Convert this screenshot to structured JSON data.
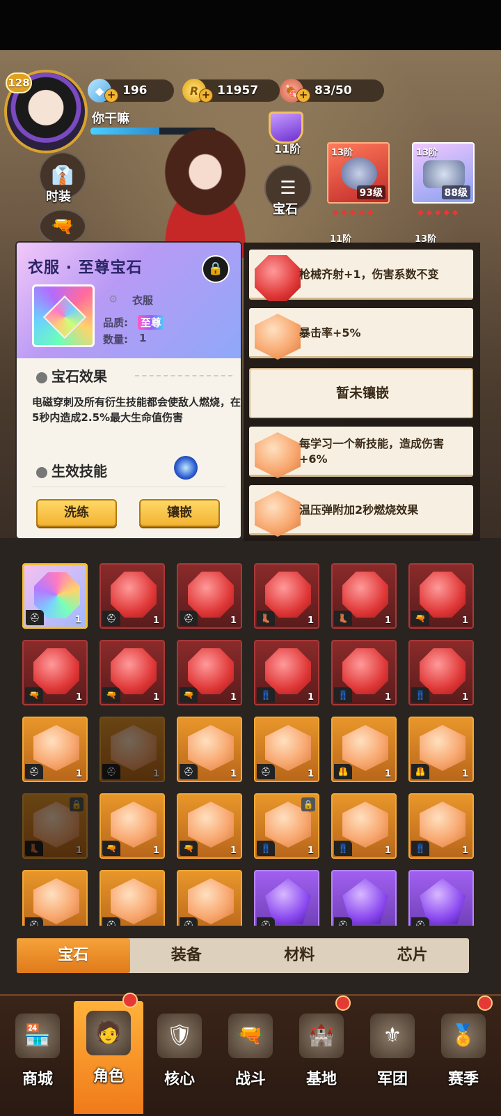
{
  "header": {
    "level": "128",
    "player_name": "你干嘛",
    "exp_fraction": 0.55,
    "resources": {
      "diamonds": "196",
      "coins": "11957",
      "stamina": "83/50"
    }
  },
  "side_buttons": {
    "fashion_label": "时装",
    "gem_label": "宝石",
    "rank_label": "11阶"
  },
  "equipment": [
    {
      "tier": "13阶",
      "level": "93级"
    },
    {
      "tier": "13阶",
      "level": "88级"
    },
    {
      "tier": "11阶"
    },
    {
      "tier": "13阶"
    }
  ],
  "detail": {
    "title": "衣服 · 至尊宝石",
    "slot_type": "衣服",
    "quality_label": "品质:",
    "quality_value": "至尊",
    "count_label": "数量:",
    "count_value": "1",
    "effect_title": "宝石效果",
    "effect_text": "电磁穿刺及所有衍生技能都会使敌人燃烧，在5秒内造成2.5%最大生命值伤害",
    "skill_title": "生效技能",
    "refine_button": "洗练",
    "inlay_button": "镶嵌"
  },
  "slots": [
    {
      "gem": "red",
      "text": "枪械齐射+1，伤害系数不变"
    },
    {
      "gem": "orange",
      "text": "暴击率+5%"
    },
    {
      "gem": "none",
      "text": "暂未镶嵌"
    },
    {
      "gem": "orange",
      "text": "每学习一个新技能，造成伤害+6%"
    },
    {
      "gem": "orange",
      "text": "温压弹附加2秒燃烧效果"
    }
  ],
  "inventory": [
    {
      "color": "rainbow",
      "icon": "helmet",
      "count": "1"
    },
    {
      "color": "red",
      "icon": "helmet",
      "count": "1"
    },
    {
      "color": "red",
      "icon": "helmet",
      "count": "1"
    },
    {
      "color": "red",
      "icon": "boot",
      "count": "1"
    },
    {
      "color": "red",
      "icon": "boot",
      "count": "1"
    },
    {
      "color": "red",
      "icon": "gun",
      "count": "1"
    },
    {
      "color": "red",
      "icon": "gun",
      "count": "1"
    },
    {
      "color": "red",
      "icon": "gun",
      "count": "1"
    },
    {
      "color": "red",
      "icon": "gun",
      "count": "1"
    },
    {
      "color": "red",
      "icon": "pants",
      "count": "1"
    },
    {
      "color": "red",
      "icon": "pants",
      "count": "1"
    },
    {
      "color": "red",
      "icon": "pants",
      "count": "1"
    },
    {
      "color": "orange",
      "icon": "helmet",
      "count": "1"
    },
    {
      "color": "orange",
      "icon": "helmet",
      "count": "1",
      "dim": true
    },
    {
      "color": "orange",
      "icon": "helmet",
      "count": "1"
    },
    {
      "color": "orange",
      "icon": "helmet",
      "count": "1"
    },
    {
      "color": "orange",
      "icon": "armor",
      "count": "1"
    },
    {
      "color": "orange",
      "icon": "armor",
      "count": "1"
    },
    {
      "color": "orange",
      "icon": "boot",
      "count": "1",
      "dim": true,
      "locked": true
    },
    {
      "color": "orange",
      "icon": "gun",
      "count": "1"
    },
    {
      "color": "orange",
      "icon": "gun",
      "count": "1"
    },
    {
      "color": "orange",
      "icon": "pants",
      "count": "1",
      "locked": true
    },
    {
      "color": "orange",
      "icon": "pants",
      "count": "1"
    },
    {
      "color": "orange",
      "icon": "pants",
      "count": "1"
    },
    {
      "color": "orange",
      "icon": "helmet",
      "count": ""
    },
    {
      "color": "orange",
      "icon": "helmet",
      "count": ""
    },
    {
      "color": "orange",
      "icon": "helmet",
      "count": ""
    },
    {
      "color": "purple",
      "icon": "helmet",
      "count": ""
    },
    {
      "color": "purple",
      "icon": "helmet",
      "count": ""
    },
    {
      "color": "purple",
      "icon": "helmet",
      "count": ""
    }
  ],
  "tabs": [
    "宝石",
    "装备",
    "材料",
    "芯片"
  ],
  "active_tab": 0,
  "bottom_nav": [
    {
      "label": "商城",
      "badge": false
    },
    {
      "label": "角色",
      "badge": true,
      "active": true
    },
    {
      "label": "核心",
      "badge": false
    },
    {
      "label": "战斗",
      "badge": false
    },
    {
      "label": "基地",
      "badge": true
    },
    {
      "label": "军团",
      "badge": false
    },
    {
      "label": "赛季",
      "badge": true
    }
  ],
  "colors": {
    "accent_orange": "#f5a23a",
    "gem_red": "#e03838",
    "gem_purple": "#8a48f0",
    "panel_bg": "#f7f3ea"
  }
}
